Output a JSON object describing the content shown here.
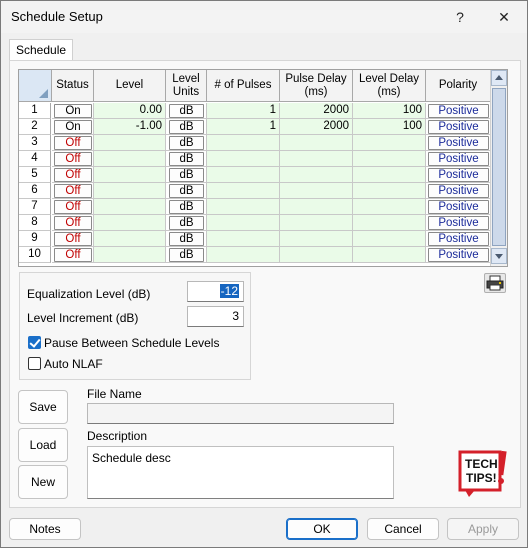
{
  "window": {
    "title": "Schedule Setup",
    "help_label": "?",
    "close_label": "✕"
  },
  "tabs": [
    {
      "label": "Schedule"
    }
  ],
  "grid": {
    "headers": {
      "status": "Status",
      "level": "Level",
      "level_units_1": "Level",
      "level_units_2": "Units",
      "pulses": "# of Pulses",
      "pulse_delay_1": "Pulse Delay",
      "pulse_delay_2": "(ms)",
      "level_delay_1": "Level Delay",
      "level_delay_2": "(ms)",
      "polarity": "Polarity"
    },
    "rows": [
      {
        "num": "1",
        "status": "On",
        "level": "0.00",
        "units": "dB",
        "pulses": "1",
        "pulse_delay": "2000",
        "level_delay": "100",
        "polarity": "Positive"
      },
      {
        "num": "2",
        "status": "On",
        "level": "-1.00",
        "units": "dB",
        "pulses": "1",
        "pulse_delay": "2000",
        "level_delay": "100",
        "polarity": "Positive"
      },
      {
        "num": "3",
        "status": "Off",
        "level": "",
        "units": "dB",
        "pulses": "",
        "pulse_delay": "",
        "level_delay": "",
        "polarity": "Positive"
      },
      {
        "num": "4",
        "status": "Off",
        "level": "",
        "units": "dB",
        "pulses": "",
        "pulse_delay": "",
        "level_delay": "",
        "polarity": "Positive"
      },
      {
        "num": "5",
        "status": "Off",
        "level": "",
        "units": "dB",
        "pulses": "",
        "pulse_delay": "",
        "level_delay": "",
        "polarity": "Positive"
      },
      {
        "num": "6",
        "status": "Off",
        "level": "",
        "units": "dB",
        "pulses": "",
        "pulse_delay": "",
        "level_delay": "",
        "polarity": "Positive"
      },
      {
        "num": "7",
        "status": "Off",
        "level": "",
        "units": "dB",
        "pulses": "",
        "pulse_delay": "",
        "level_delay": "",
        "polarity": "Positive"
      },
      {
        "num": "8",
        "status": "Off",
        "level": "",
        "units": "dB",
        "pulses": "",
        "pulse_delay": "",
        "level_delay": "",
        "polarity": "Positive"
      },
      {
        "num": "9",
        "status": "Off",
        "level": "",
        "units": "dB",
        "pulses": "",
        "pulse_delay": "",
        "level_delay": "",
        "polarity": "Positive"
      },
      {
        "num": "10",
        "status": "Off",
        "level": "",
        "units": "dB",
        "pulses": "",
        "pulse_delay": "",
        "level_delay": "",
        "polarity": "Positive"
      }
    ]
  },
  "settings": {
    "eq_level_label": "Equalization Level (dB)",
    "eq_level_value": "-12",
    "level_increment_label": "Level Increment (dB)",
    "level_increment_value": "3",
    "pause_label": "Pause Between Schedule Levels",
    "pause_checked": true,
    "auto_nlaf_label": "Auto NLAF",
    "auto_nlaf_checked": false
  },
  "file": {
    "file_name_label": "File Name",
    "file_name_value": "",
    "description_label": "Description",
    "description_value": "Schedule desc"
  },
  "side_buttons": {
    "save": "Save",
    "load": "Load",
    "new": "New"
  },
  "tech_tips": {
    "line1": "TECH",
    "line2": "TIPS!"
  },
  "footer": {
    "notes": "Notes",
    "ok": "OK",
    "cancel": "Cancel",
    "apply": "Apply"
  },
  "colors": {
    "accent": "#1a6fc9",
    "status_off": "#c00000",
    "polarity": "#1a2a9a",
    "cell_green": "#eafbe8",
    "tech_tips_red": "#d4202a"
  },
  "icons": {
    "printer": "printer-icon",
    "help": "help-icon",
    "close": "close-icon"
  }
}
